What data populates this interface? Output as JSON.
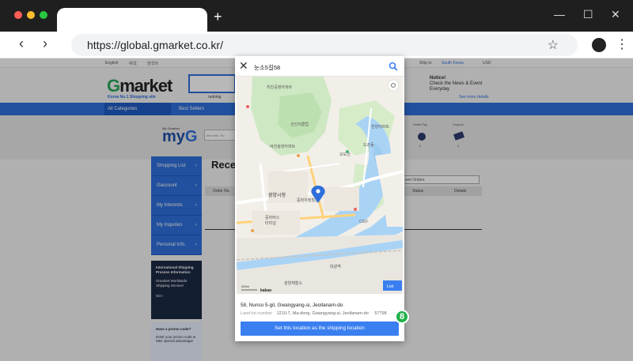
{
  "browser": {
    "url": "https://global.gmarket.co.kr/",
    "new_tab_icon": "+",
    "controls": [
      "—",
      "☐",
      "✕"
    ]
  },
  "site": {
    "top_links": [
      "English",
      "中文",
      "한국어"
    ],
    "ship_to_label": "Ship to",
    "ship_to_value": "South Korea",
    "currency": "USD",
    "logo_g": "G",
    "logo_rest": "market",
    "logo_tagline": "Korea No.1 Shopping site",
    "rankings": "ranking",
    "notice_title": "Notice!",
    "notice_text": "Check the News & Event Everyday",
    "see_more": "See more details",
    "nav": {
      "all_categories": "All Categories",
      "links": [
        "Best Sellers"
      ]
    },
    "myg": {
      "small_label": "My Gmarket",
      "title_prefix": "my",
      "title_g": "G",
      "search_placeholder": "Item info, Ro",
      "right_labels": [
        "Smile Pay",
        "Coupon"
      ],
      "right_values": [
        "0",
        "0"
      ]
    },
    "sidebar": [
      "Shopping List",
      "Gaccount",
      "My Interests",
      "My Inquiries",
      "Personal Info."
    ],
    "promo1": {
      "title": "International Shipping Process Information",
      "sub": "Gmarket Worldwide Shipping Service!",
      "go": "GO ›"
    },
    "promo2": {
      "title": "Have a promo code?",
      "sub": "Enter your promo code & take special advantage!"
    },
    "recent_title": "Rece",
    "table_headers": [
      "Order No.",
      "Status",
      "Details"
    ],
    "period_select": "Recent Orders"
  },
  "modal": {
    "query": "눈소5길58",
    "map": {
      "labels": [
        "직진공영아파트",
        "산인리클럽",
        "덕진광양아파트",
        "광양시청",
        "중마우정힐동",
        "오도진",
        "CGV",
        "대광역",
        "한양아파트",
        "중마버스",
        "터미널",
        "광양제철소",
        "도촌동"
      ],
      "list_button": "List",
      "kakao": "kakao",
      "scale": "500m"
    },
    "address": "58, Nunso 5-gil, Gwangyang-si, Jeollanam-do",
    "land_lot_label": "Land-lot number",
    "land_lot": "1210-7, Ma-dong, Gwangyang-si, Jeollanam-do",
    "postcode": "57798",
    "set_button": "Set this location as the shipping location",
    "step_badge": "8"
  }
}
